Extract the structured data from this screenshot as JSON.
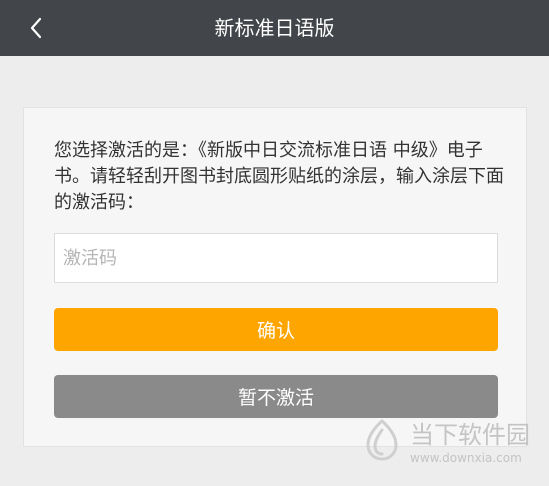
{
  "header": {
    "title": "新标准日语版"
  },
  "activation": {
    "instructions": "您选择激活的是：《新版中日交流标准日语 中级》电子书。请轻轻刮开图书封底圆形贴纸的涂层，输入涂层下面的激活码：",
    "input_placeholder": "激活码",
    "input_value": "",
    "confirm_label": "确认",
    "skip_label": "暂不激活"
  },
  "watermark": {
    "name": "当下软件园",
    "url": "www.downxia.com"
  },
  "colors": {
    "nav_background": "#424549",
    "confirm_button": "#ffa500",
    "skip_button": "#8a8a8a",
    "page_background": "#ededed"
  },
  "icons": {
    "back": "chevron-left-icon",
    "watermark_logo": "downxia-logo-icon"
  }
}
